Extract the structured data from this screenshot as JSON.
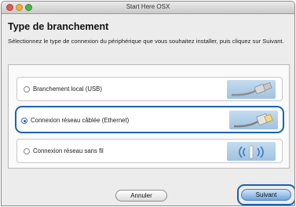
{
  "window": {
    "title": "Start Here OSX"
  },
  "heading": "Type de branchement",
  "description": "Sélectionnez le type de connexion du périphérique que vous souhaitez installer, puis cliquez sur Suivant.",
  "options": [
    {
      "label": "Branchement local (USB)",
      "selected": false,
      "icon": "usb-cable-icon"
    },
    {
      "label": "Connexion réseau câblée (Ethernet)",
      "selected": true,
      "icon": "ethernet-cable-icon"
    },
    {
      "label": "Connexion réseau sans fil",
      "selected": false,
      "icon": "wireless-antenna-icon"
    }
  ],
  "buttons": {
    "cancel": "Annuler",
    "next": "Suivant"
  },
  "colors": {
    "highlight": "#1b63b3",
    "accent": "#6fa6df"
  }
}
